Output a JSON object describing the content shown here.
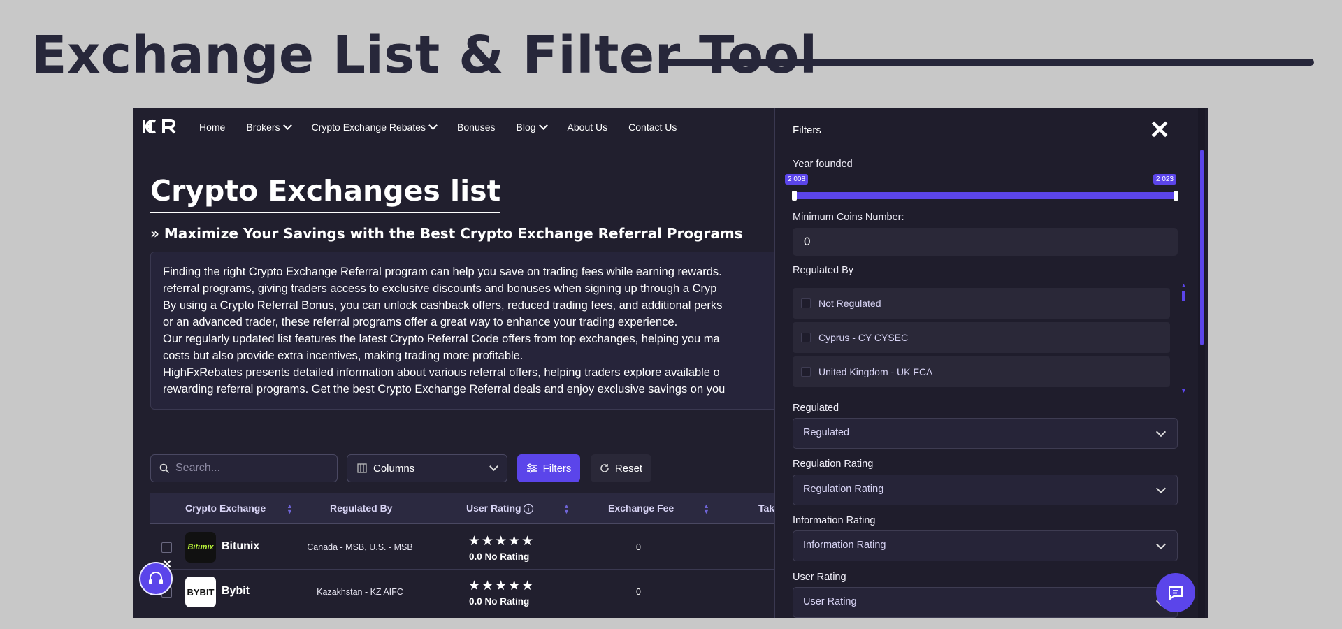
{
  "slide": {
    "title": "Exchange List & Filter Tool"
  },
  "nav": {
    "logo": "HFR",
    "items": [
      {
        "label": "Home",
        "dropdown": false
      },
      {
        "label": "Brokers",
        "dropdown": true
      },
      {
        "label": "Crypto Exchange Rebates",
        "dropdown": true
      },
      {
        "label": "Bonuses",
        "dropdown": false
      },
      {
        "label": "Blog",
        "dropdown": true
      },
      {
        "label": "About Us",
        "dropdown": false
      },
      {
        "label": "Contact Us",
        "dropdown": false
      }
    ]
  },
  "page": {
    "title": "Crypto Exchanges list",
    "subtitle": "» Maximize Your Savings with the Best Crypto Exchange Referral Programs",
    "intro": [
      "Finding the right Crypto Exchange Referral program can help you save on trading fees while earning rewards.",
      "referral programs, giving traders access to exclusive discounts and bonuses when signing up through a Cryp",
      "By using a Crypto Referral Bonus, you can unlock cashback offers, reduced trading fees, and additional perks",
      "or an advanced trader, these referral programs offer a great way to enhance your trading experience.",
      "Our regularly updated list features the latest Crypto Referral Code offers from top exchanges, helping you ma",
      "costs but also provide extra incentives, making trading more profitable.",
      "HighFxRebates presents detailed information about various referral offers, helping traders explore available o",
      "rewarding referral programs. Get the best Crypto Exchange Referral deals and enjoy exclusive savings on you"
    ]
  },
  "toolbar": {
    "search_placeholder": "Search...",
    "columns_label": "Columns",
    "filters_label": "Filters",
    "reset_label": "Reset"
  },
  "table": {
    "headers": {
      "exchange": "Crypto Exchange",
      "regulated_by": "Regulated By",
      "user_rating": "User Rating",
      "fee": "Exchange Fee",
      "taker": "Tak"
    },
    "rows": [
      {
        "logo": "Bitunix",
        "name": "Bitunix",
        "regulated_by": "Canada - MSB, U.S. - MSB",
        "stars": "★★★★★",
        "rating": "0.0 No Rating",
        "fee": "0"
      },
      {
        "logo": "BYBIT",
        "name": "Bybit",
        "regulated_by": "Kazakhstan - KZ AIFC",
        "stars": "★★★★★",
        "rating": "0.0 No Rating",
        "fee": "0"
      }
    ]
  },
  "filters": {
    "title": "Filters",
    "year_label": "Year founded",
    "year_min": "2 008",
    "year_max": "2 023",
    "coins_label": "Minimum Coins Number:",
    "coins_value": "0",
    "regulated_by_label": "Regulated By",
    "regulators": [
      "Not Regulated",
      "Cyprus - CY CYSEC",
      "United Kingdom - UK FCA"
    ],
    "regulated_label": "Regulated",
    "regulated_value": "Regulated",
    "regulation_rating_label": "Regulation Rating",
    "regulation_rating_value": "Regulation Rating",
    "information_rating_label": "Information Rating",
    "information_rating_value": "Information Rating",
    "user_rating_label": "User Rating",
    "user_rating_value": "User Rating"
  },
  "colors": {
    "accent": "#5b45ea",
    "background": "#211f2e",
    "slide_bg": "#c8c8c8"
  }
}
